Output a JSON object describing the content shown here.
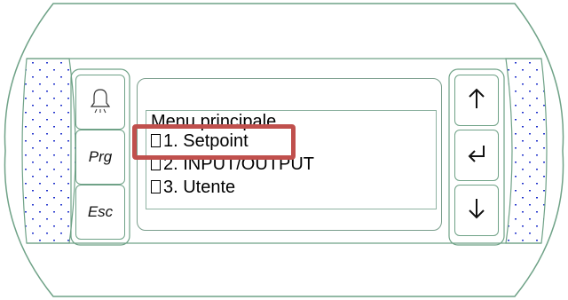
{
  "keypad": {
    "alarm_icon": "bell-icon",
    "prg_label": "Prg",
    "esc_label": "Esc",
    "up_icon": "up-arrow-icon",
    "enter_icon": "enter-icon",
    "down_icon": "down-arrow-icon"
  },
  "display": {
    "title": "Menu principale",
    "items": [
      {
        "label": "1. Setpoint"
      },
      {
        "label": "2. INPUT/OUTPUT"
      },
      {
        "label": "3. Utente"
      }
    ]
  },
  "colors": {
    "panel_stroke": "#6fa287",
    "dot_color": "#2233cc",
    "highlight": "#c0504d"
  }
}
